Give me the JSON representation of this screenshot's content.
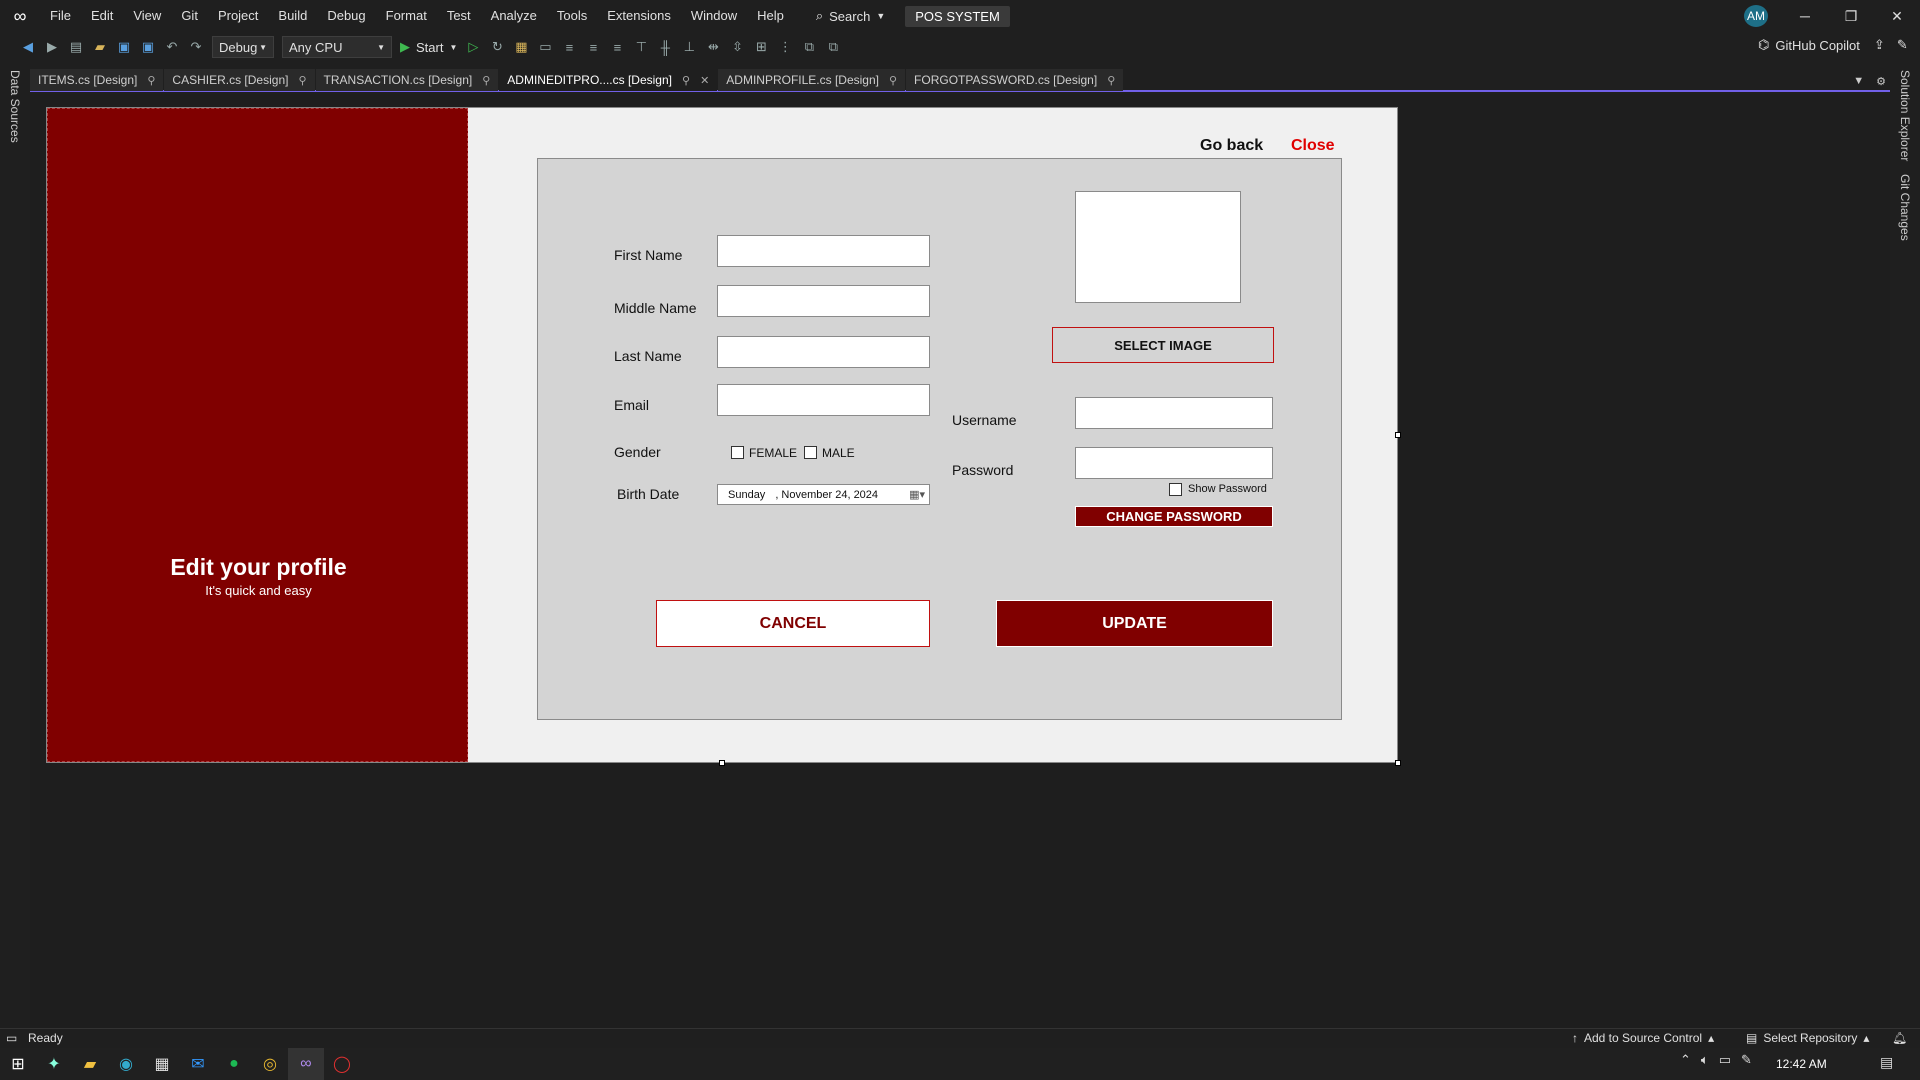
{
  "menu": {
    "items": [
      "File",
      "Edit",
      "View",
      "Git",
      "Project",
      "Build",
      "Debug",
      "Format",
      "Test",
      "Analyze",
      "Tools",
      "Extensions",
      "Window",
      "Help"
    ],
    "search_label": "Search",
    "solution_name": "POS SYSTEM",
    "avatar_initials": "AM"
  },
  "toolbar": {
    "config": "Debug",
    "platform": "Any CPU",
    "start_label": "Start",
    "copilot_label": "GitHub Copilot"
  },
  "side": {
    "left_label": "Data Sources",
    "right_label_1": "Solution Explorer",
    "right_label_2": "Git Changes"
  },
  "tabs": [
    {
      "label": "ITEMS.cs [Design]"
    },
    {
      "label": "CASHIER.cs [Design]"
    },
    {
      "label": "TRANSACTION.cs [Design]"
    },
    {
      "label": "ADMINEDITPRO....cs [Design]"
    },
    {
      "label": "ADMINPROFILE.cs [Design]"
    },
    {
      "label": "FORGOTPASSWORD.cs [Design]"
    }
  ],
  "form": {
    "title": "Edit your profile",
    "subtitle": "It's quick and easy",
    "go_back": "Go back",
    "close": "Close",
    "labels": {
      "first_name": "First Name",
      "middle_name": "Middle Name",
      "last_name": "Last Name",
      "email": "Email",
      "gender": "Gender",
      "birth_date": "Birth Date",
      "username": "Username",
      "password": "Password"
    },
    "gender_options": {
      "female": "FEMALE",
      "male": "MALE"
    },
    "birth_date_value": {
      "day": "Sunday",
      "date": ",  November 24, 2024"
    },
    "select_image": "SELECT IMAGE",
    "show_password": "Show Password",
    "change_password": "CHANGE PASSWORD",
    "cancel": "CANCEL",
    "update": "UPDATE"
  },
  "status": {
    "ready": "Ready",
    "source_control": "Add to Source Control",
    "select_repo": "Select Repository",
    "time": "12:42 AM"
  },
  "colors": {
    "brand_maroon": "#800000",
    "accent_purple": "#7160e8",
    "close_red": "#e00000"
  }
}
